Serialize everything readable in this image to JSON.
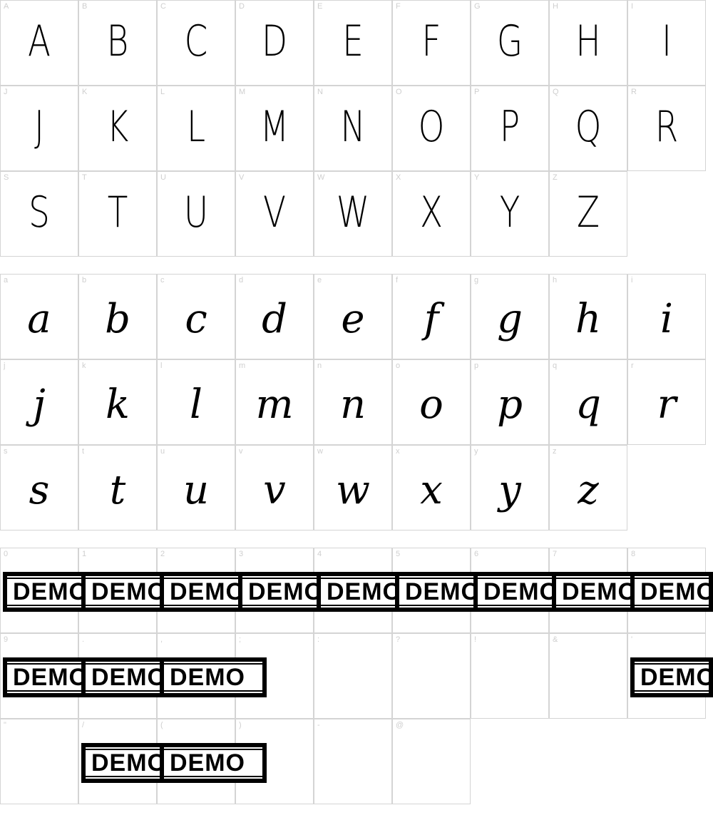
{
  "uppercase": [
    "A",
    "B",
    "C",
    "D",
    "E",
    "F",
    "G",
    "H",
    "I",
    "J",
    "K",
    "L",
    "M",
    "N",
    "O",
    "P",
    "Q",
    "R",
    "S",
    "T",
    "U",
    "V",
    "W",
    "X",
    "Y",
    "Z"
  ],
  "lowercase": [
    "a",
    "b",
    "c",
    "d",
    "e",
    "f",
    "g",
    "h",
    "i",
    "j",
    "k",
    "l",
    "m",
    "n",
    "o",
    "p",
    "q",
    "r",
    "s",
    "t",
    "u",
    "v",
    "w",
    "x",
    "y",
    "z"
  ],
  "symbols": {
    "labels": [
      "0",
      "1",
      "2",
      "3",
      "4",
      "5",
      "6",
      "7",
      "8",
      "9",
      ".",
      ",",
      ";",
      ":",
      "?",
      "!",
      "&",
      "'",
      "\"",
      "/",
      "(",
      ")",
      "-",
      "@"
    ],
    "placeholder_text": "DEMO"
  }
}
